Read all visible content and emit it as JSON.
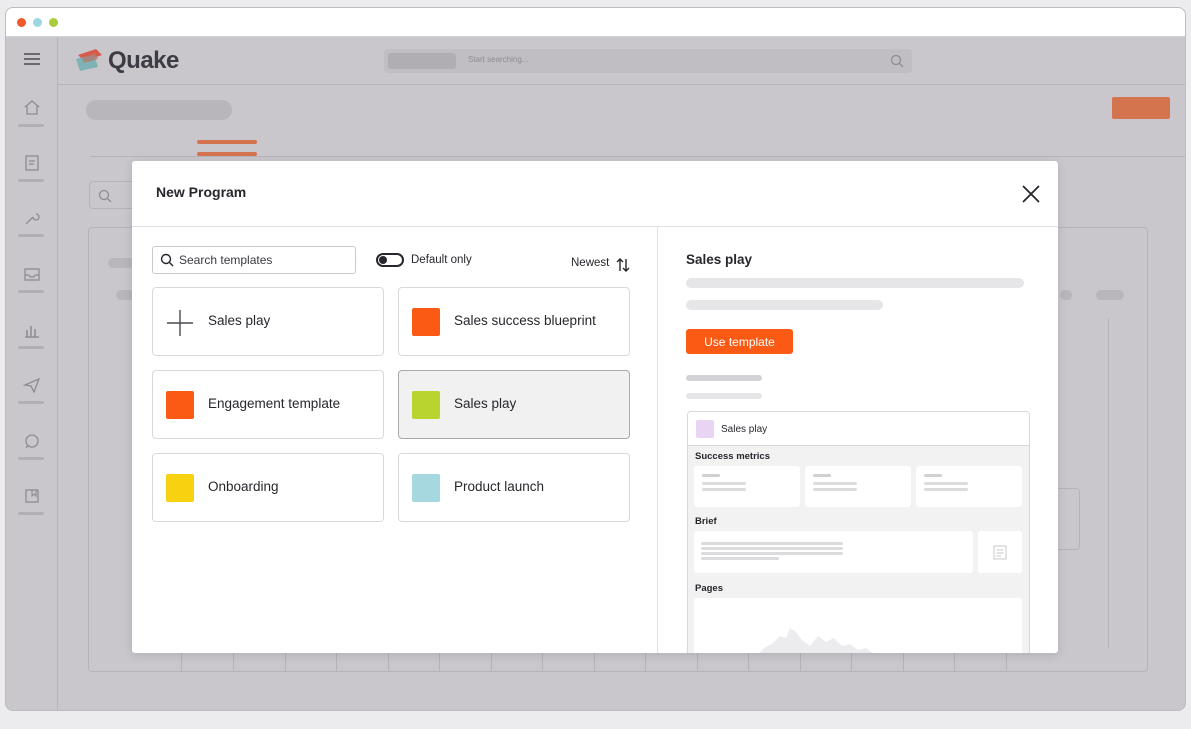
{
  "app": {
    "name": "Quake",
    "search_placeholder": "Start searching..."
  },
  "modal": {
    "title": "New Program",
    "search_placeholder": "Search templates",
    "toggle_label": "Default only",
    "sort_label": "Newest",
    "templates": [
      {
        "label": "Sales play",
        "icon": "plus-icon",
        "color": ""
      },
      {
        "label": "Sales success blueprint",
        "icon": "",
        "color": "#fa5a14"
      },
      {
        "label": "Engagement template",
        "icon": "",
        "color": "#fa5a14"
      },
      {
        "label": "Sales play",
        "icon": "",
        "color": "#b9d42f",
        "selected": true
      },
      {
        "label": "Onboarding",
        "icon": "",
        "color": "#f8d210"
      },
      {
        "label": "Product launch",
        "icon": "",
        "color": "#a6d9df"
      }
    ],
    "preview": {
      "title": "Sales play",
      "use_button": "Use template",
      "card_title": "Sales play",
      "sections": {
        "metrics": "Success metrics",
        "brief": "Brief",
        "pages": "Pages"
      }
    }
  },
  "colors": {
    "accent": "#fa5a14"
  }
}
